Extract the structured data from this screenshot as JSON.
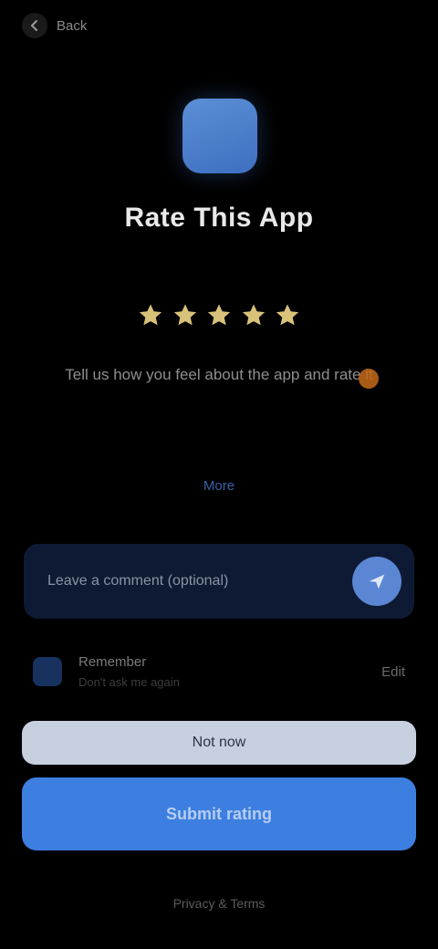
{
  "header": {
    "back_label": "Back"
  },
  "app": {
    "title": "Rate This App"
  },
  "rating": {
    "stars_total": 5,
    "stars_filled": 5,
    "star_color": "#d8c27a",
    "text": "Tell us how you feel about the app and rate it",
    "emoji_icon": "heart-emoji-icon"
  },
  "mid_link": {
    "label": "More"
  },
  "comment": {
    "placeholder": "Leave a comment (optional)",
    "send_icon": "send-icon"
  },
  "option": {
    "title": "Remember",
    "subtitle": "Don't ask me again",
    "right_label": "Edit"
  },
  "buttons": {
    "secondary_label": "Not now",
    "primary_label": "Submit rating"
  },
  "footer": {
    "link_label": "Privacy & Terms"
  },
  "colors": {
    "background": "#000000",
    "accent": "#3d7fe0",
    "app_icon": "#4c7fcc"
  }
}
